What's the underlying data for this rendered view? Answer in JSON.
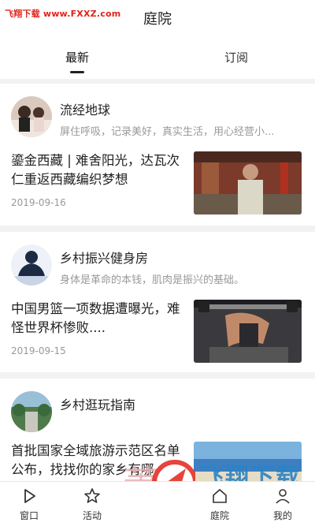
{
  "header": {
    "watermark": "飞翔下载 www.FXXZ.com",
    "title": "庭院"
  },
  "tabs": [
    {
      "label": "最新",
      "active": true
    },
    {
      "label": "订阅",
      "active": false
    }
  ],
  "feed": [
    {
      "author": "流经地球",
      "bio": "屏住呼吸，记录美好，真实生活，用心经营小...",
      "headline": "鎏金西藏 | 难舍阳光，达瓦次仁重返西藏编织梦想",
      "date": "2019-09-16",
      "avatar_icon": "person-avatar",
      "thumb_icon": "photo-thumbnail"
    },
    {
      "author": "乡村振兴健身房",
      "bio": "身体是革命的本钱，肌肉是振兴的基础。",
      "headline": "中国男篮一项数据遭曝光，难怪世界杯惨败....",
      "date": "2019-09-15",
      "avatar_icon": "bodybuilder-avatar",
      "thumb_icon": "gym-photo-thumbnail"
    },
    {
      "author": "乡村逛玩指南",
      "bio": "",
      "headline": "首批国家全域旅游示范区名单公布，找找你的家乡有哪",
      "date": "",
      "avatar_icon": "landscape-avatar",
      "thumb_icon": "beach-photo-thumbnail"
    }
  ],
  "bottom_nav": [
    {
      "label": "窗口",
      "icon": "play-icon",
      "active": false
    },
    {
      "label": "活动",
      "icon": "star-icon",
      "active": false
    },
    {
      "label": "庭院",
      "icon": "home-icon",
      "active": true
    },
    {
      "label": "我的",
      "icon": "user-icon",
      "active": false
    }
  ],
  "watermark_bottom": {
    "brand": "飞翔下载",
    "url": "www.FXXZ.com"
  },
  "colors": {
    "watermark_red": "#e2231a",
    "watermark_blue": "#2a84c7",
    "secondary_text": "#999999",
    "background": "#f2f2f2"
  }
}
